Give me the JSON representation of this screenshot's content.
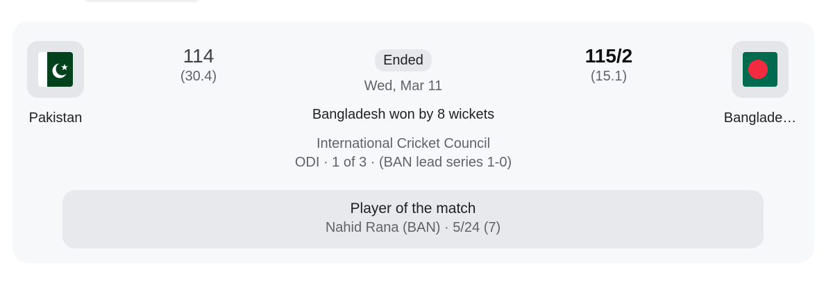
{
  "match": {
    "status": "Ended",
    "date": "Wed, Mar 11",
    "result": "Bangladesh won by 8 wickets",
    "organizer": "International Cricket Council",
    "series": "ODI · 1 of 3 · (BAN lead series 1-0)"
  },
  "teams": {
    "home": {
      "name": "Pakistan",
      "runs": "114",
      "overs": "(30.4)",
      "flag_icon": "pakistan-flag-icon"
    },
    "away": {
      "name": "Banglade…",
      "runs": "115/2",
      "overs": "(15.1)",
      "flag_icon": "bangladesh-flag-icon"
    }
  },
  "player_of_match": {
    "title": "Player of the match",
    "detail": "Nahid Rana (BAN) · 5/24 (7)"
  },
  "colors": {
    "card_background": "#f7f8fa",
    "pill_background": "#e8e9ed",
    "pakistan_green": "#01411c",
    "bangladesh_green": "#006a4e",
    "bangladesh_red": "#f42a41"
  }
}
